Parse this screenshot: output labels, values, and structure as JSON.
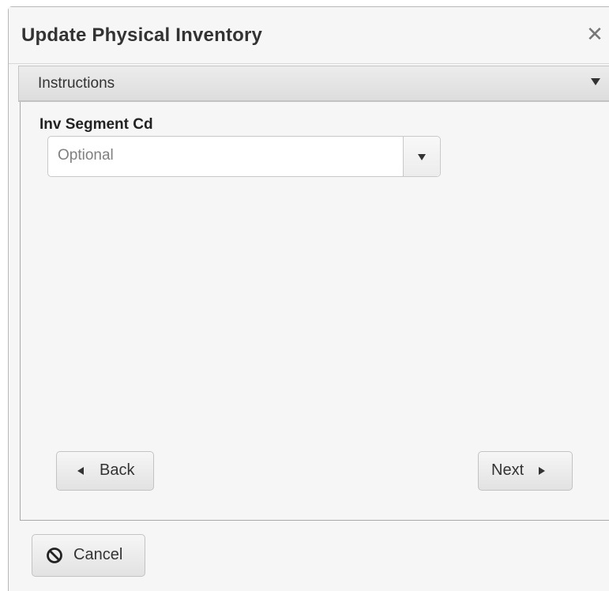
{
  "dialog": {
    "title": "Update Physical Inventory",
    "close_icon": "close-icon",
    "close_glyph": "✕"
  },
  "accordion": {
    "label": "Instructions",
    "icon": "chevron-down-icon"
  },
  "form": {
    "inv_segment_cd": {
      "label": "Inv Segment Cd",
      "placeholder": "Optional",
      "value": ""
    }
  },
  "navigation": {
    "back_label": "Back",
    "next_label": "Next"
  },
  "footer": {
    "cancel_label": "Cancel",
    "cancel_icon": "cancel-icon"
  },
  "colors": {
    "background": "#f6f6f6",
    "text": "#333333",
    "placeholder": "#808080"
  }
}
